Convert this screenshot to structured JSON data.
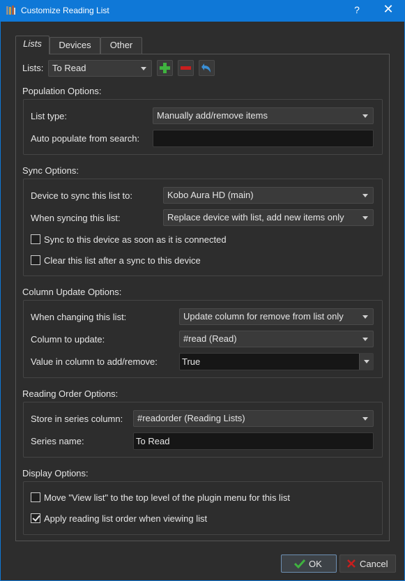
{
  "window": {
    "title": "Customize Reading List",
    "help_glyph": "?",
    "close_glyph": "✕",
    "app_icon": "calibre-books-icon"
  },
  "tabs": [
    {
      "label": "Lists",
      "active": true
    },
    {
      "label": "Devices",
      "active": false
    },
    {
      "label": "Other",
      "active": false
    }
  ],
  "lists_row": {
    "label": "Lists:",
    "selected": "To Read",
    "buttons": [
      "add-list-icon",
      "remove-list-icon",
      "rename-list-icon"
    ]
  },
  "population": {
    "title": "Population Options:",
    "list_type_label": "List type:",
    "list_type_value": "Manually add/remove items",
    "auto_populate_label": "Auto populate from search:",
    "auto_populate_value": ""
  },
  "sync": {
    "title": "Sync Options:",
    "device_label": "Device to sync this list to:",
    "device_value": "Kobo Aura HD (main)",
    "when_label": "When syncing this list:",
    "when_value": "Replace device with list, add new items only",
    "sync_connected_label": "Sync to this device as soon as it is connected",
    "sync_connected_checked": false,
    "clear_after_label": "Clear this list after a sync to this device",
    "clear_after_checked": false
  },
  "column_update": {
    "title": "Column Update Options:",
    "when_changing_label": "When changing this list:",
    "when_changing_value": "Update column for remove from list only",
    "column_label": "Column to update:",
    "column_value": "#read (Read)",
    "value_label": "Value in column to add/remove:",
    "value_value": "True"
  },
  "reading_order": {
    "title": "Reading Order Options:",
    "store_label": "Store in series column:",
    "store_value": "#readorder (Reading Lists)",
    "series_label": "Series name:",
    "series_value": "To Read"
  },
  "display": {
    "title": "Display Options:",
    "move_view_label": "Move \"View list\" to the top level of the plugin menu for this list",
    "move_view_checked": false,
    "apply_order_label": "Apply reading list order when viewing list",
    "apply_order_checked": true
  },
  "footer": {
    "ok_label": "OK",
    "cancel_label": "Cancel"
  },
  "colors": {
    "titlebar": "#0f78d7",
    "add_green": "#3fb23f",
    "remove_red": "#c81e1e",
    "rename_blue": "#3a8fd6"
  }
}
